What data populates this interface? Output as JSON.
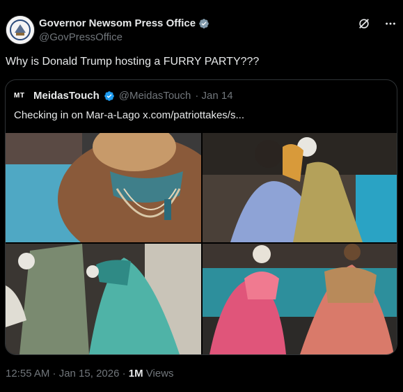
{
  "post": {
    "display_name": "Governor Newsom Press Office",
    "handle": "@GovPressOffice",
    "text": "Why is Donald Trump hosting a FURRY PARTY???",
    "timestamp": "12:55 AM · Jan 15, 2026",
    "separator": " · ",
    "views_count": "1M",
    "views_label": " Views"
  },
  "quote": {
    "logo_text": "MT",
    "display_name": "MeidasTouch",
    "handle": "@MeidasTouch",
    "date": "· Jan 14",
    "text": "Checking in on Mar-a-Lago  x.com/patriottakes/s..."
  },
  "media": [
    {
      "id": "media-1",
      "alt": "close-up of ornate beaded collar"
    },
    {
      "id": "media-2",
      "alt": "costumed dancers by a pool"
    },
    {
      "id": "media-3",
      "alt": "costumed figures in teal gowns"
    },
    {
      "id": "media-4",
      "alt": "animal-masked dancers in pink costumes"
    }
  ],
  "colors": {
    "verified": "#1d9bf0",
    "text": "#e7e9ea",
    "muted": "#71767b",
    "border": "#2f3336"
  },
  "icons": [
    "verified-badge-icon",
    "grok-icon",
    "more-icon"
  ]
}
